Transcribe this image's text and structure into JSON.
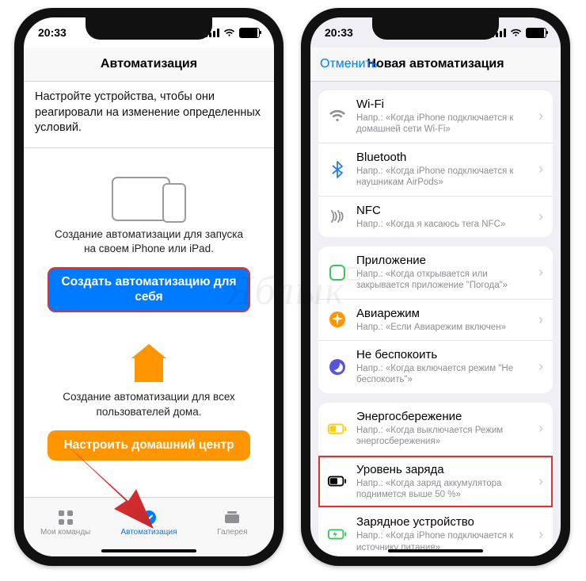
{
  "watermark": "Яблык",
  "status_time": "20:33",
  "left": {
    "nav_title": "Автоматизация",
    "intro": "Настройте устройства, чтобы они реагировали на изменение определенных условий.",
    "card1_text": "Создание автоматизации для запуска на своем iPhone или iPad.",
    "card1_btn": "Создать автоматизацию для себя",
    "card2_text": "Создание автоматизации для всех пользователей дома.",
    "card2_btn": "Настроить домашний центр",
    "tabs": {
      "commands": "Мои команды",
      "automation": "Автоматизация",
      "gallery": "Галерея"
    }
  },
  "right": {
    "nav_cancel": "Отменить",
    "nav_title": "Новая автоматизация",
    "rows": {
      "wifi": {
        "t": "Wi-Fi",
        "s": "Напр.: «Когда iPhone подключается к домашней сети Wi-Fi»"
      },
      "bt": {
        "t": "Bluetooth",
        "s": "Напр.: «Когда iPhone подключается к наушникам AirPods»"
      },
      "nfc": {
        "t": "NFC",
        "s": "Напр.: «Когда я касаюсь тега NFC»"
      },
      "app": {
        "t": "Приложение",
        "s": "Напр.: «Когда открывается или закрывается приложение \"Погода\"»"
      },
      "air": {
        "t": "Авиарежим",
        "s": "Напр.: «Если Авиарежим включен»"
      },
      "dnd": {
        "t": "Не беспокоить",
        "s": "Напр.: «Когда включается режим \"Не беспокоить\"»"
      },
      "low": {
        "t": "Энергосбережение",
        "s": "Напр.: «Когда выключается Режим энергосбережения»"
      },
      "lvl": {
        "t": "Уровень заряда",
        "s": "Напр.: «Когда заряд аккумулятора поднимется выше 50 %»"
      },
      "chg": {
        "t": "Зарядное устройство",
        "s": "Напр.: «Когда iPhone подключается к источнику питания»"
      }
    }
  }
}
